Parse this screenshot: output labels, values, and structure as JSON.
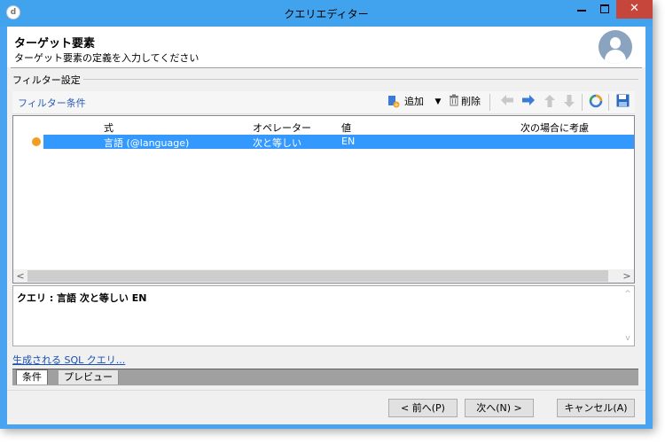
{
  "window": {
    "title": "クエリエディター",
    "app_icon_glyph": "d",
    "close_glyph": "✕"
  },
  "header": {
    "title": "ターゲット要素",
    "subtitle": "ターゲット要素の定義を入力してください"
  },
  "filter_group": {
    "label": "フィルター設定"
  },
  "toolbar": {
    "section_label": "フィルター条件",
    "add_label": "追加",
    "delete_label": "削除",
    "icons": [
      "add-icon",
      "dropdown-arrow-icon",
      "trash-icon",
      "arrow-left-icon",
      "arrow-right-icon",
      "arrow-up-icon",
      "arrow-down-icon",
      "refresh-icon",
      "save-icon"
    ]
  },
  "grid": {
    "columns": [
      "式",
      "オペレーター",
      "値",
      "次の場合に考慮"
    ],
    "rows": [
      {
        "expression": "言語 (@language)",
        "operator": "次と等しい",
        "value": "EN",
        "consider": ""
      }
    ]
  },
  "query_preview": {
    "text": "クエリ : 言語 次と等しい EN"
  },
  "sql_link": "生成される SQL クエリ...",
  "tabs": [
    {
      "label": "条件",
      "active": true
    },
    {
      "label": "プレビュー",
      "active": false
    }
  ],
  "footer": {
    "prev": "< 前へ(P)",
    "next": "次へ(N) >",
    "cancel": "キャンセル(A)"
  },
  "colors": {
    "titlebar": "#41a3ee",
    "selection": "#3399ff",
    "close": "#c7463b"
  }
}
